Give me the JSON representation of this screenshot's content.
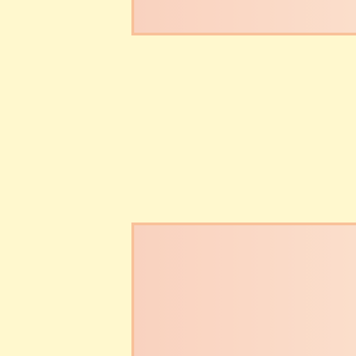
{
  "colors": {
    "background": "#FFF8CE",
    "block_fill_start": "#F9D2BF",
    "block_fill_end": "#FBDECB",
    "block_border": "#F8C199"
  }
}
